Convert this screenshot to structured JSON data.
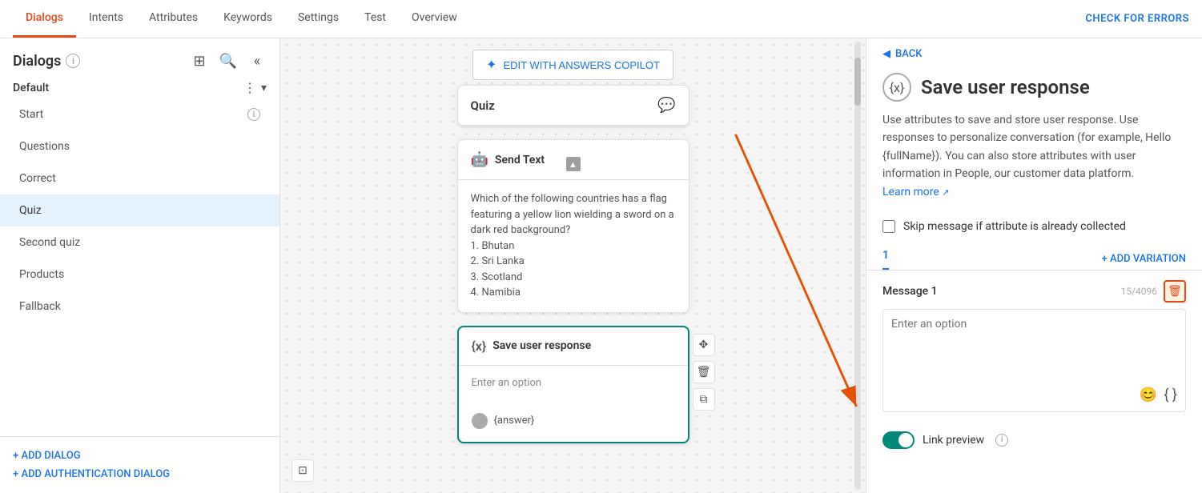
{
  "topNav": {
    "tabs": [
      {
        "id": "dialogs",
        "label": "Dialogs",
        "active": true
      },
      {
        "id": "intents",
        "label": "Intents",
        "active": false
      },
      {
        "id": "attributes",
        "label": "Attributes",
        "active": false
      },
      {
        "id": "keywords",
        "label": "Keywords",
        "active": false
      },
      {
        "id": "settings",
        "label": "Settings",
        "active": false
      },
      {
        "id": "test",
        "label": "Test",
        "active": false
      },
      {
        "id": "overview",
        "label": "Overview",
        "active": false
      }
    ],
    "checkErrors": "CHECK FOR ERRORS"
  },
  "sidebar": {
    "title": "Dialogs",
    "sectionLabel": "Default",
    "items": [
      {
        "id": "start",
        "label": "Start",
        "hasInfo": true,
        "active": false
      },
      {
        "id": "questions",
        "label": "Questions",
        "hasInfo": false,
        "active": false
      },
      {
        "id": "correct",
        "label": "Correct",
        "hasInfo": false,
        "active": false
      },
      {
        "id": "quiz",
        "label": "Quiz",
        "hasInfo": false,
        "active": true
      },
      {
        "id": "second-quiz",
        "label": "Second quiz",
        "hasInfo": false,
        "active": false
      },
      {
        "id": "products",
        "label": "Products",
        "hasInfo": false,
        "active": false
      },
      {
        "id": "fallback",
        "label": "Fallback",
        "hasInfo": false,
        "active": false
      }
    ],
    "addDialog": "+ ADD DIALOG",
    "addAuthDialog": "+ ADD AUTHENTICATION DIALOG"
  },
  "canvas": {
    "editCopilotBtn": "EDIT WITH ANSWERS COPILOT",
    "quizCard": {
      "title": "Quiz",
      "iconType": "chat"
    },
    "sendTextCard": {
      "title": "Send Text",
      "body": "Which of the following countries has a flag featuring a yellow lion wielding a sword on a dark red background?\n1. Bhutan\n2. Sri Lanka\n3. Scotland\n4. Namibia"
    },
    "saveUserCard": {
      "title": "Save user response",
      "placeholder": "Enter an option",
      "answerChip": "{answer}"
    }
  },
  "rightPanel": {
    "backLabel": "BACK",
    "title": "Save user response",
    "description": "Use attributes to save and store user response. Use responses to personalize conversation (for example, Hello {fullName}). You can also store attributes with user information in People, our customer data platform.",
    "learnMore": "Learn more",
    "skipMessage": "Skip message if attribute is already collected",
    "variationTab": "1",
    "addVariation": "+ ADD VARIATION",
    "messageLabel": "Message 1",
    "charCount": "15/4096",
    "messagePlaceholder": "Enter an option",
    "linkPreview": "Link preview"
  }
}
